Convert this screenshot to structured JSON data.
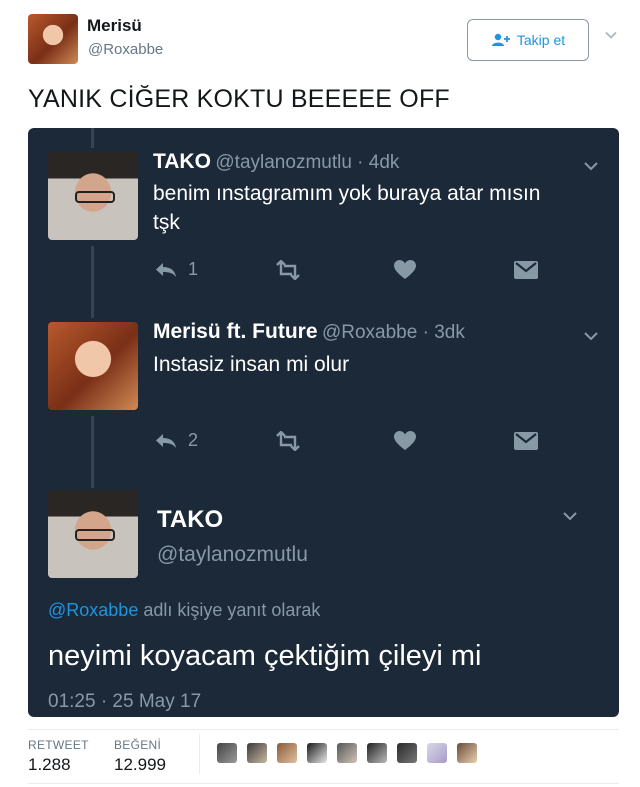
{
  "outer_tweet": {
    "author_name": "Merisü",
    "author_handle": "@Roxabbe",
    "follow_label": "Takip et",
    "text": "YANIK CİĞER KOKTU BEEEEE OFF"
  },
  "embedded": {
    "reply1": {
      "name": "TAKO",
      "handle": "@taylanozmutlu · 4dk",
      "text_line1": "benim ınstagramım yok buraya atar mısın",
      "text_line2": "tşk",
      "reply_count": "1"
    },
    "reply2": {
      "name": "Merisü ft. Future",
      "handle": "@Roxabbe · 3dk",
      "text": "Instasiz insan mi olur",
      "reply_count": "2"
    },
    "main": {
      "name": "TAKO",
      "handle": "@taylanozmutlu",
      "reply_to_handle": "@Roxabbe",
      "reply_to_suffix": " adlı kişiye yanıt olarak",
      "text": "neyimi koyacam çektiğim çileyi mi",
      "timestamp": "01:25 · 25 May 17"
    }
  },
  "stats": {
    "retweet_label": "RETWEET",
    "retweet_count": "1.288",
    "like_label": "BEĞENİ",
    "like_count": "12.999"
  },
  "colors": {
    "dark_bg": "#1c2938",
    "link_blue": "#1b95e0",
    "muted": "#8899a6"
  }
}
